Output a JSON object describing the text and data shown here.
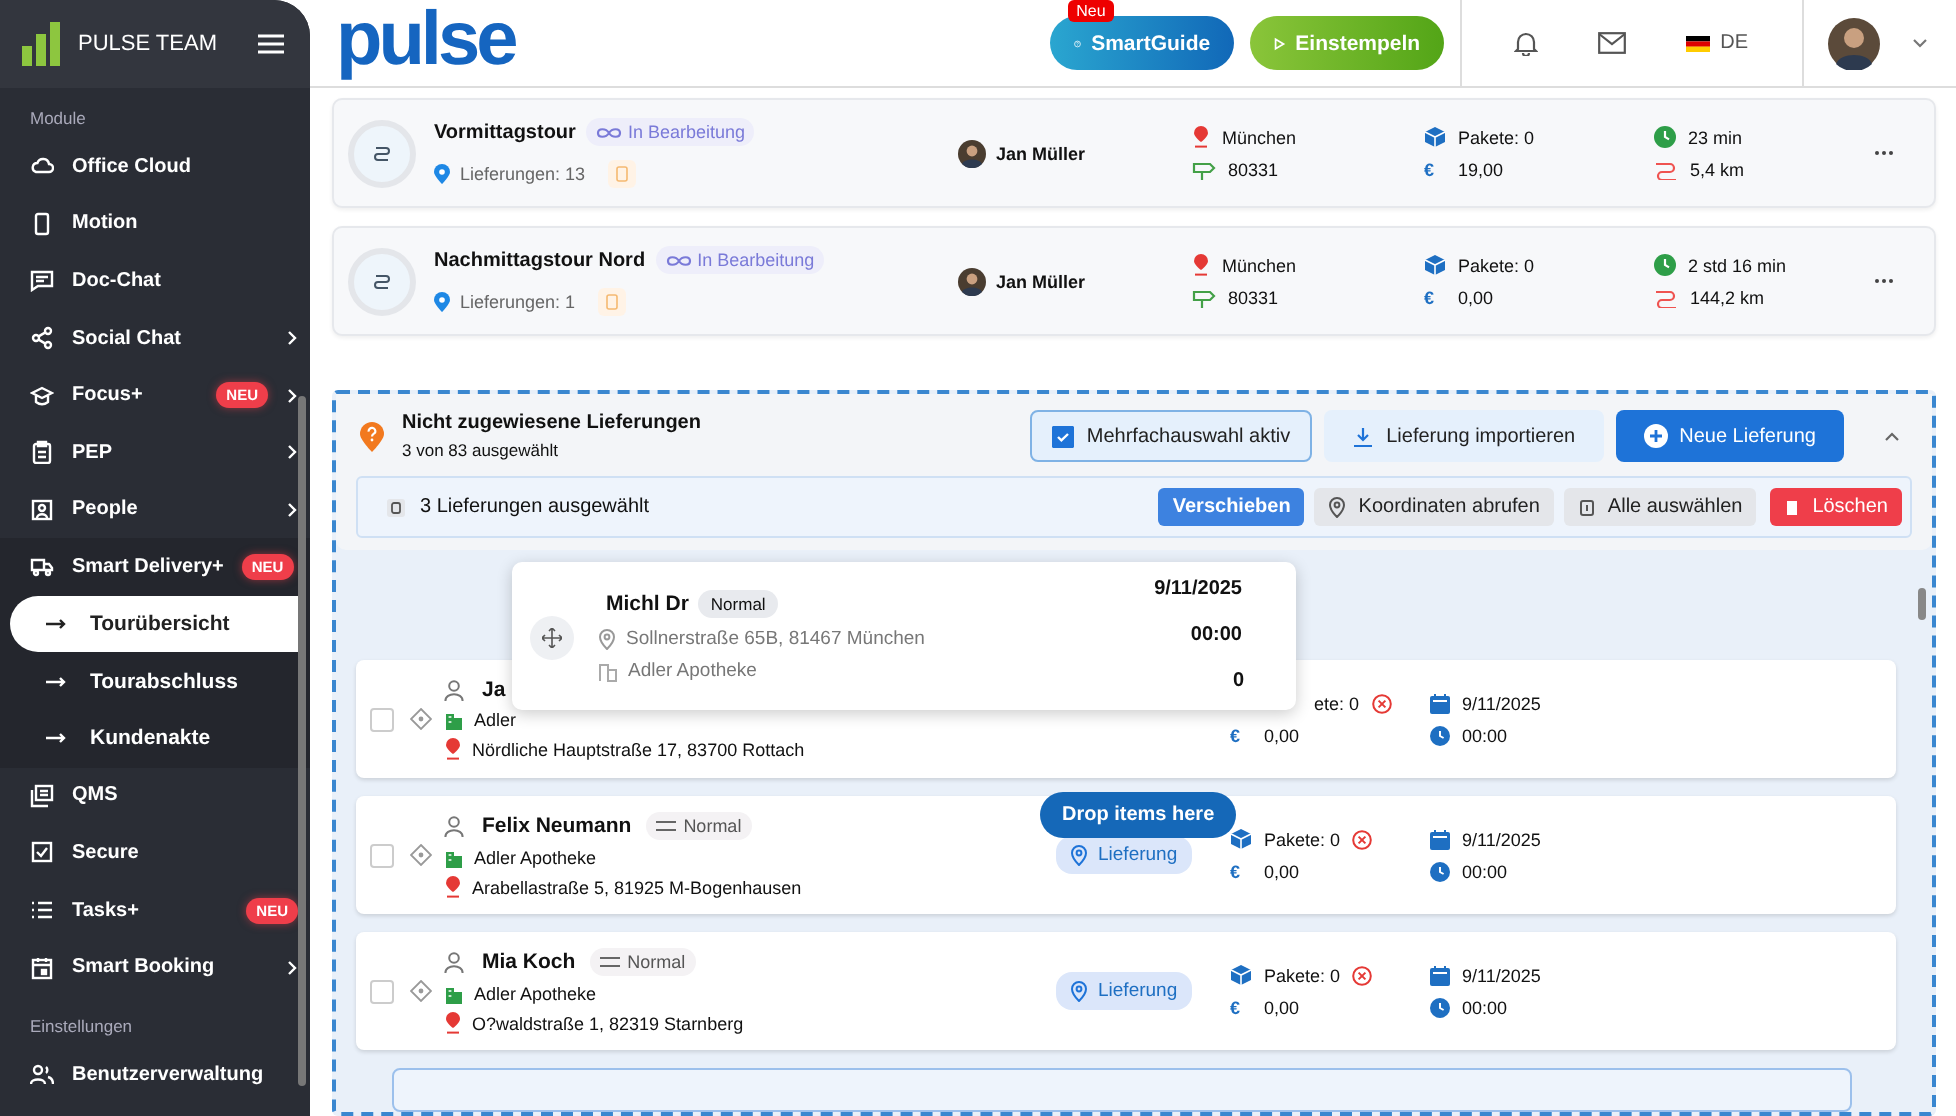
{
  "sidebar": {
    "brand": "PULSE TEAM",
    "sections": [
      {
        "label": "Module",
        "items": [
          {
            "label": "Office Cloud",
            "expandable": false,
            "expanded": false,
            "selected": false
          },
          {
            "label": "Motion",
            "expandable": false,
            "expanded": false,
            "selected": false
          },
          {
            "label": "Doc-Chat",
            "expandable": false,
            "expanded": false,
            "selected": false
          },
          {
            "label": "Social Chat",
            "expandable": true,
            "expanded": false,
            "selected": false
          },
          {
            "label": "Focus+",
            "badge": "NEU",
            "expandable": true,
            "expanded": false,
            "selected": false
          },
          {
            "label": "PEP",
            "expandable": true,
            "expanded": false,
            "selected": false
          },
          {
            "label": "People",
            "expandable": true,
            "expanded": false,
            "selected": false
          },
          {
            "label": "Smart Delivery+",
            "badge": "NEU",
            "expandable": true,
            "expanded": true,
            "selected": false,
            "children": [
              {
                "label": "Tourübersicht",
                "selected": true
              },
              {
                "label": "Tourabschluss",
                "selected": false
              },
              {
                "label": "Kundenakte",
                "selected": false
              }
            ]
          },
          {
            "label": "QMS",
            "expandable": false,
            "expanded": false,
            "selected": false
          },
          {
            "label": "Secure",
            "expandable": false,
            "expanded": false,
            "selected": false
          },
          {
            "label": "Tasks+",
            "badge": "NEU",
            "expandable": false,
            "expanded": false,
            "selected": false
          },
          {
            "label": "Smart Booking",
            "expandable": true,
            "expanded": false,
            "selected": false
          }
        ]
      },
      {
        "label": "Einstellungen",
        "items": [
          {
            "label": "Benutzerverwaltung",
            "expandable": false,
            "expanded": false,
            "selected": false
          }
        ]
      }
    ]
  },
  "topbar": {
    "logo": "pulse",
    "guide_badge": "Neu",
    "guide_button": "SmartGuide",
    "clock_button": "Einstempeln",
    "language": "DE"
  },
  "tours": [
    {
      "name": "Vormittagstour",
      "status": "In Bearbeitung",
      "deliveries": "Lieferungen: 13",
      "driver": "Jan Müller",
      "city": "München",
      "zip": "80331",
      "packages": "Pakete: 0",
      "currency": "€",
      "price": "19,00",
      "duration": "23 min",
      "distance": "5,4 km"
    },
    {
      "name": "Nachmittagstour Nord",
      "status": "In Bearbeitung",
      "deliveries": "Lieferungen: 1",
      "driver": "Jan Müller",
      "city": "München",
      "zip": "80331",
      "packages": "Pakete: 0",
      "currency": "€",
      "price": "0,00",
      "duration": "2 std 16 min",
      "distance": "144,2 km"
    }
  ],
  "unassigned": {
    "title": "Nicht zugewiesene Lieferungen",
    "subtitle": "3 von 83 ausgewählt",
    "multi_select": {
      "label": "Mehrfachauswahl aktiv",
      "checked": true
    },
    "import_button": "Lieferung importieren",
    "new_button": "Neue Lieferung",
    "expanded": true,
    "selection": {
      "label": "3 Lieferungen ausgewählt",
      "actions": [
        {
          "label": "Verschieben",
          "kind": "primary"
        },
        {
          "label": "Koordinaten abrufen",
          "kind": "pin"
        },
        {
          "label": "Alle auswählen",
          "kind": "select"
        },
        {
          "label": "Löschen",
          "kind": "danger"
        }
      ]
    },
    "drag_preview": {
      "name": "Michl Dr",
      "priority": "Normal",
      "address": "Sollnerstraße 65B, 81467 München",
      "pharmacy": "Adler Apotheke",
      "date": "9/11/2025",
      "time": "00:00",
      "count": "0"
    },
    "drop_hint": "Drop items here",
    "deliveries": [
      {
        "checked": false,
        "name": "Ja",
        "pharmacy": "Adler",
        "address": "Nördliche Hauptstraße 17, 83700 Rottach",
        "packages": "ete: 0",
        "currency": "€",
        "price": "0,00",
        "date": "9/11/2025",
        "time": "00:00"
      },
      {
        "checked": false,
        "name": "Felix Neumann",
        "priority": "Normal",
        "pharmacy": "Adler Apotheke",
        "address": "Arabellastraße 5, 81925 M-Bogenhausen",
        "type": "Lieferung",
        "packages": "Pakete: 0",
        "currency": "€",
        "price": "0,00",
        "date": "9/11/2025",
        "time": "00:00"
      },
      {
        "checked": false,
        "name": "Mia Koch",
        "priority": "Normal",
        "pharmacy": "Adler Apotheke",
        "address": "O?waldstraße 1, 82319 Starnberg",
        "type": "Lieferung",
        "packages": "Pakete: 0",
        "currency": "€",
        "price": "0,00",
        "date": "9/11/2025",
        "time": "00:00"
      }
    ]
  }
}
